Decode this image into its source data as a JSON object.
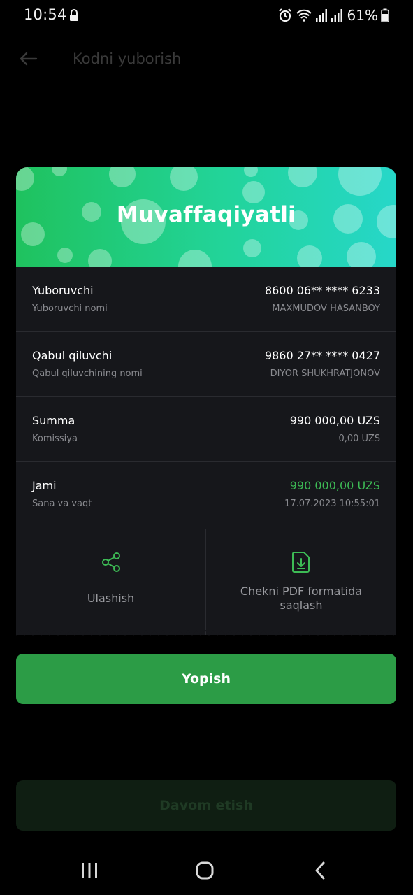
{
  "status_bar": {
    "time": "10:54",
    "battery": "61%",
    "icons": [
      "lock-icon",
      "alarm-icon",
      "wifi-icon",
      "signal-icon",
      "signal-icon",
      "battery-icon"
    ]
  },
  "header": {
    "title": "Kodni yuborish",
    "back_icon": "arrow-left-icon"
  },
  "receipt": {
    "banner_title": "Muvaffaqiyatli",
    "rows": [
      {
        "label": "Yuboruvchi",
        "sublabel": "Yuboruvchi nomi",
        "value": "8600 06** **** 6233",
        "subvalue": "MAXMUDOV HASANBOY"
      },
      {
        "label": "Qabul qiluvchi",
        "sublabel": "Qabul qiluvchining nomi",
        "value": "9860 27** **** 0427",
        "subvalue": "DIYOR SHUKHRATJONOV"
      },
      {
        "label": "Summa",
        "sublabel": "Komissiya",
        "value": "990 000,00 UZS",
        "subvalue": "0,00 UZS"
      },
      {
        "label": "Jami",
        "sublabel": "Sana va vaqt",
        "value": "990 000,00 UZS",
        "subvalue": "17.07.2023 10:55:01"
      }
    ],
    "actions": {
      "share": {
        "label": "Ulashish",
        "icon": "share-icon"
      },
      "pdf": {
        "line1": "Chekni PDF formatida",
        "line2": "saqlash",
        "icon": "file-download-icon"
      }
    }
  },
  "buttons": {
    "close": "Yopish",
    "continue": "Davom etish"
  },
  "colors": {
    "accent_green": "#2c9c46",
    "total_green": "#3dbb55",
    "banner_start": "#1fc25e",
    "banner_end": "#26d7c9"
  },
  "nav": {
    "recent": "recent-apps-icon",
    "home": "home-icon",
    "back": "back-icon"
  }
}
